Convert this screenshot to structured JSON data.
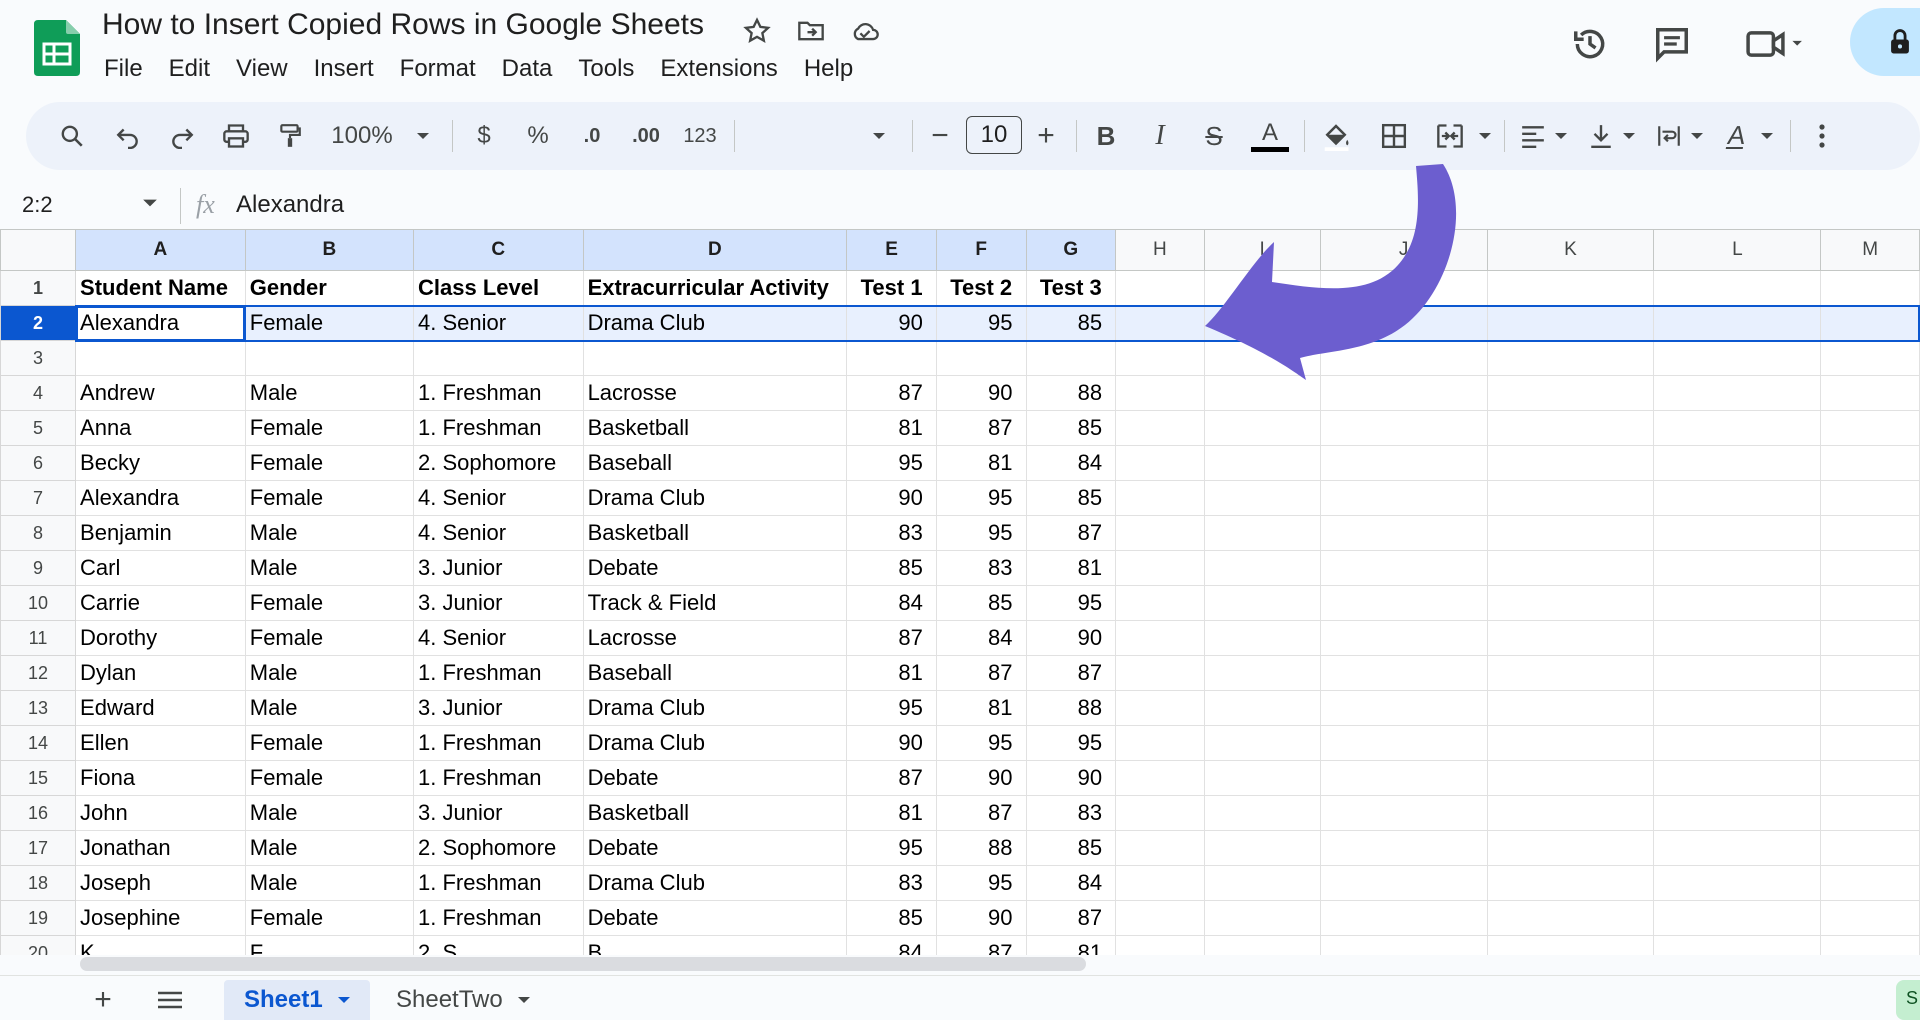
{
  "header": {
    "title": "How to Insert Copied Rows in Google Sheets",
    "icons": [
      "star-icon",
      "move-icon",
      "cloud-saved-icon",
      "history-icon",
      "comment-icon",
      "meet-icon",
      "lock-icon"
    ]
  },
  "menu": [
    "File",
    "Edit",
    "View",
    "Insert",
    "Format",
    "Data",
    "Tools",
    "Extensions",
    "Help"
  ],
  "toolbar": {
    "zoom": "100%",
    "currency": "$",
    "percent": "%",
    "decrease_decimal": ".0",
    "increase_decimal": ".00",
    "number_format": "123",
    "font": "",
    "font_size": "10",
    "minus": "−",
    "plus": "+",
    "bold": "B",
    "italic": "I",
    "strike": "S",
    "text_color": "A",
    "text_color_bar": "#000000",
    "rotate": "A"
  },
  "formula_bar": {
    "name_box": "2:2",
    "fx": "fx",
    "content": "Alexandra"
  },
  "columns": [
    "A",
    "B",
    "C",
    "D",
    "E",
    "F",
    "G",
    "H",
    "I",
    "J",
    "K",
    "L",
    "M"
  ],
  "rows": [
    {
      "n": "1",
      "cells": [
        "Student Name",
        "Gender",
        "Class Level",
        "Extracurricular Activity",
        "Test 1",
        "Test 2",
        "Test 3"
      ]
    },
    {
      "n": "2",
      "cells": [
        "Alexandra",
        "Female",
        "4. Senior",
        "Drama Club",
        "90",
        "95",
        "85"
      ]
    },
    {
      "n": "3",
      "cells": [
        "",
        "",
        "",
        "",
        "",
        "",
        ""
      ]
    },
    {
      "n": "4",
      "cells": [
        "Andrew",
        "Male",
        "1. Freshman",
        "Lacrosse",
        "87",
        "90",
        "88"
      ]
    },
    {
      "n": "5",
      "cells": [
        "Anna",
        "Female",
        "1. Freshman",
        "Basketball",
        "81",
        "87",
        "85"
      ]
    },
    {
      "n": "6",
      "cells": [
        "Becky",
        "Female",
        "2. Sophomore",
        "Baseball",
        "95",
        "81",
        "84"
      ]
    },
    {
      "n": "7",
      "cells": [
        "Alexandra",
        "Female",
        "4. Senior",
        "Drama Club",
        "90",
        "95",
        "85"
      ]
    },
    {
      "n": "8",
      "cells": [
        "Benjamin",
        "Male",
        "4. Senior",
        "Basketball",
        "83",
        "95",
        "87"
      ]
    },
    {
      "n": "9",
      "cells": [
        "Carl",
        "Male",
        "3. Junior",
        "Debate",
        "85",
        "83",
        "81"
      ]
    },
    {
      "n": "10",
      "cells": [
        "Carrie",
        "Female",
        "3. Junior",
        "Track & Field",
        "84",
        "85",
        "95"
      ]
    },
    {
      "n": "11",
      "cells": [
        "Dorothy",
        "Female",
        "4. Senior",
        "Lacrosse",
        "87",
        "84",
        "90"
      ]
    },
    {
      "n": "12",
      "cells": [
        "Dylan",
        "Male",
        "1. Freshman",
        "Baseball",
        "81",
        "87",
        "87"
      ]
    },
    {
      "n": "13",
      "cells": [
        "Edward",
        "Male",
        "3. Junior",
        "Drama Club",
        "95",
        "81",
        "88"
      ]
    },
    {
      "n": "14",
      "cells": [
        "Ellen",
        "Female",
        "1. Freshman",
        "Drama Club",
        "90",
        "95",
        "95"
      ]
    },
    {
      "n": "15",
      "cells": [
        "Fiona",
        "Female",
        "1. Freshman",
        "Debate",
        "87",
        "90",
        "90"
      ]
    },
    {
      "n": "16",
      "cells": [
        "John",
        "Male",
        "3. Junior",
        "Basketball",
        "81",
        "87",
        "83"
      ]
    },
    {
      "n": "17",
      "cells": [
        "Jonathan",
        "Male",
        "2. Sophomore",
        "Debate",
        "95",
        "88",
        "85"
      ]
    },
    {
      "n": "18",
      "cells": [
        "Joseph",
        "Male",
        "1. Freshman",
        "Drama Club",
        "83",
        "95",
        "84"
      ]
    },
    {
      "n": "19",
      "cells": [
        "Josephine",
        "Female",
        "1. Freshman",
        "Debate",
        "85",
        "90",
        "87"
      ]
    },
    {
      "n": "20",
      "cells": [
        "K",
        "F",
        "2. S",
        "B",
        "84",
        "87",
        "81"
      ]
    }
  ],
  "sheets": {
    "add": "+",
    "list": "≡",
    "tabs": [
      "Sheet1",
      "SheetTwo"
    ],
    "explore": "S"
  },
  "colors": {
    "accent": "#0b57d0",
    "selection": "#e8f0fe",
    "arrow": "#6c5ecf"
  }
}
